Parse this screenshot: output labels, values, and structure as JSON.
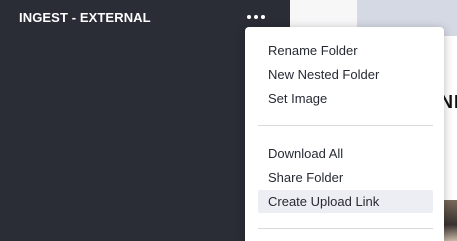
{
  "sidebar": {
    "folder_title": "INGEST - EXTERNAL",
    "more_icon": "more-horizontal-icon"
  },
  "menu": {
    "groups": [
      [
        "Rename Folder",
        "New Nested Folder",
        "Set Image"
      ],
      [
        "Download All",
        "Share Folder",
        "Create Upload Link"
      ]
    ],
    "highlighted": "Create Upload Link"
  },
  "main": {
    "heading_fragment": "NI"
  },
  "colors": {
    "sidebar_bg": "#2b2d36",
    "menu_bg": "#ffffff",
    "menu_hover": "#eceef3",
    "text": "#262a33"
  }
}
